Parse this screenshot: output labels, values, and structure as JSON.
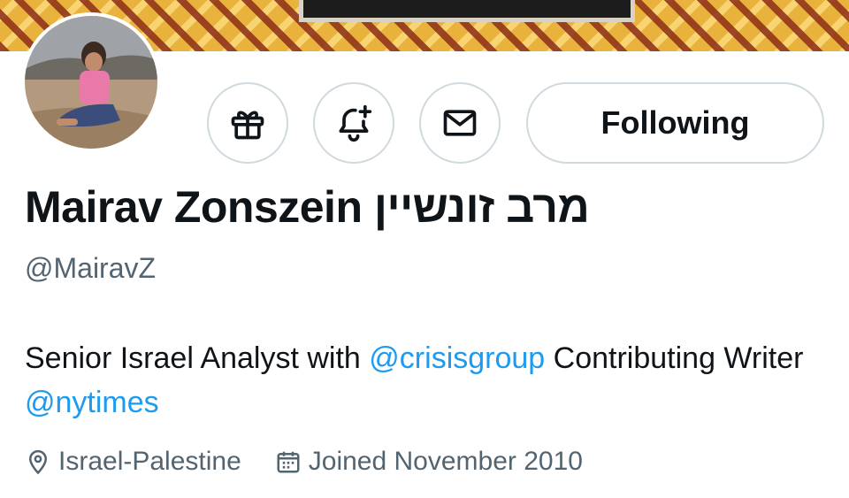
{
  "profile": {
    "name": "Mairav Zonszein מרב זונשיין",
    "handle": "@MairavZ",
    "follow_label": "Following",
    "bio": {
      "text1": "Senior Israel Analyst with ",
      "mention1": "@crisisgroup",
      "text2": " Contributing Writer ",
      "mention2": "@nytimes"
    },
    "location": "Israel-Palestine",
    "joined": "Joined November 2010"
  },
  "icons": {
    "gift": "gift-icon",
    "notify": "bell-plus-icon",
    "message": "envelope-icon",
    "location": "map-pin-icon",
    "calendar": "calendar-icon"
  },
  "colors": {
    "link": "#1d9bf0",
    "secondary_text": "#536471",
    "border": "#cfd9de",
    "primary_text": "#0f1419"
  }
}
